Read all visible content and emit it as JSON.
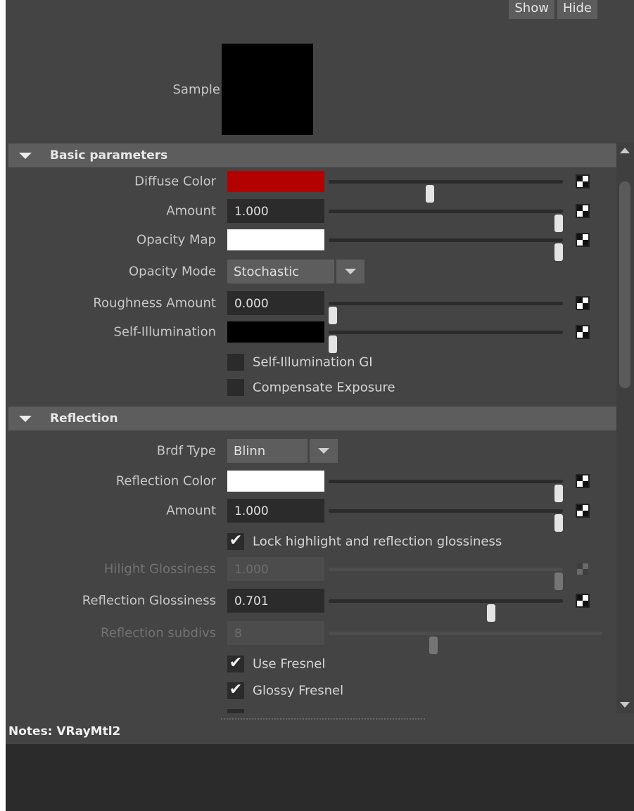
{
  "header": {
    "show_label": "Show",
    "hide_label": "Hide",
    "sample_label": "Sample"
  },
  "sections": {
    "basic": {
      "title": "Basic parameters"
    },
    "reflection": {
      "title": "Reflection"
    }
  },
  "basic": {
    "diffuse_color": {
      "label": "Diffuse Color",
      "color": "#b30000",
      "slider": 0.43
    },
    "amount": {
      "label": "Amount",
      "value": "1.000",
      "slider": 1.0
    },
    "opacity_map": {
      "label": "Opacity Map",
      "color": "#ffffff",
      "slider": 1.0
    },
    "opacity_mode": {
      "label": "Opacity Mode",
      "value": "Stochastic"
    },
    "roughness": {
      "label": "Roughness Amount",
      "value": "0.000",
      "slider": 0.0
    },
    "self_illum": {
      "label": "Self-Illumination",
      "color": "#000000",
      "slider": 0.0
    },
    "self_illum_gi": {
      "label": "Self-Illumination GI",
      "checked": false
    },
    "compensate": {
      "label": "Compensate Exposure",
      "checked": false
    }
  },
  "reflection": {
    "brdf": {
      "label": "Brdf Type",
      "value": "Blinn"
    },
    "color": {
      "label": "Reflection Color",
      "color": "#ffffff",
      "slider": 1.0
    },
    "amount": {
      "label": "Amount",
      "value": "1.000",
      "slider": 1.0
    },
    "lock": {
      "label": "Lock highlight and reflection glossiness",
      "checked": true
    },
    "hilight_gloss": {
      "label": "Hilight Glossiness",
      "value": "1.000",
      "slider": 1.0
    },
    "refl_gloss": {
      "label": "Reflection Glossiness",
      "value": "0.701",
      "slider": 0.701
    },
    "subdivs": {
      "label": "Reflection subdivs",
      "value": "8",
      "slider": 0.38
    },
    "use_fresnel": {
      "label": "Use Fresnel",
      "checked": true
    },
    "glossy_fresnel": {
      "label": "Glossy Fresnel",
      "checked": true
    }
  },
  "notes": {
    "label": "Notes:  VRayMtl2"
  },
  "colors": {
    "panel": "#444444",
    "header": "#5d5d5d",
    "field": "#2b2b2b"
  }
}
